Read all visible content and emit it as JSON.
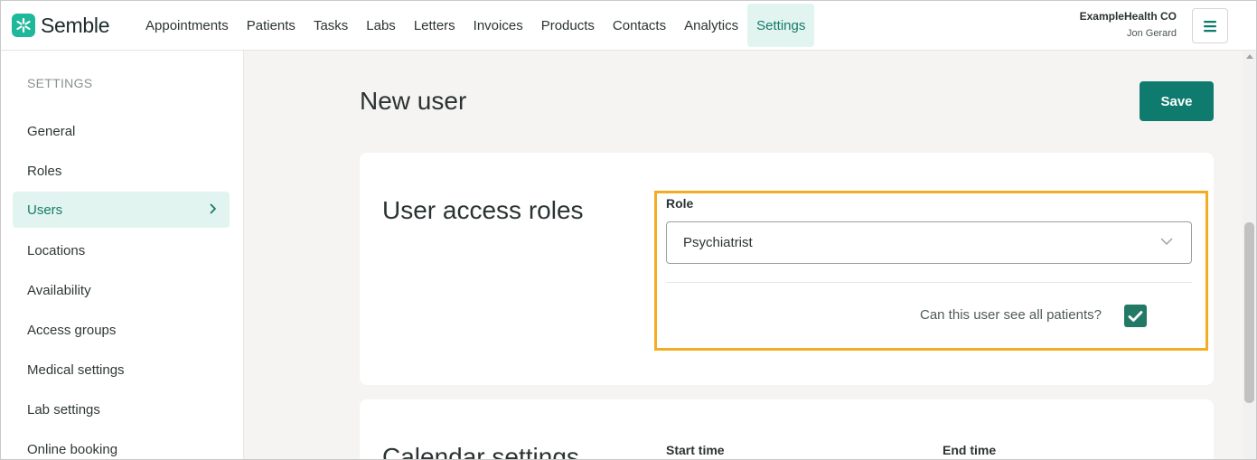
{
  "brand": {
    "name": "Semble",
    "color": "#1fb89a"
  },
  "nav": {
    "items": [
      {
        "label": "Appointments"
      },
      {
        "label": "Patients"
      },
      {
        "label": "Tasks"
      },
      {
        "label": "Labs"
      },
      {
        "label": "Letters"
      },
      {
        "label": "Invoices"
      },
      {
        "label": "Products"
      },
      {
        "label": "Contacts"
      },
      {
        "label": "Analytics"
      },
      {
        "label": "Settings",
        "active": true
      }
    ]
  },
  "account": {
    "org": "ExampleHealth CO",
    "user": "Jon Gerard",
    "menu_icon": "hamburger-icon"
  },
  "sidebar": {
    "heading": "SETTINGS",
    "items": [
      {
        "label": "General"
      },
      {
        "label": "Roles"
      },
      {
        "label": "Users",
        "active": true
      },
      {
        "label": "Locations"
      },
      {
        "label": "Availability"
      },
      {
        "label": "Access groups"
      },
      {
        "label": "Medical settings"
      },
      {
        "label": "Lab settings"
      },
      {
        "label": "Online booking"
      }
    ]
  },
  "page": {
    "title": "New user",
    "save_label": "Save"
  },
  "access_roles": {
    "title": "User access roles",
    "role_label": "Role",
    "role_value": "Psychiatrist",
    "see_all_label": "Can this user see all patients?",
    "see_all_checked": true
  },
  "calendar_settings": {
    "title": "Calendar settings",
    "start_time_label": "Start time",
    "end_time_label": "End time"
  },
  "colors": {
    "accent": "#0f7a6e",
    "highlight": "#f4ad22",
    "active_bg": "#e1f4ef"
  }
}
